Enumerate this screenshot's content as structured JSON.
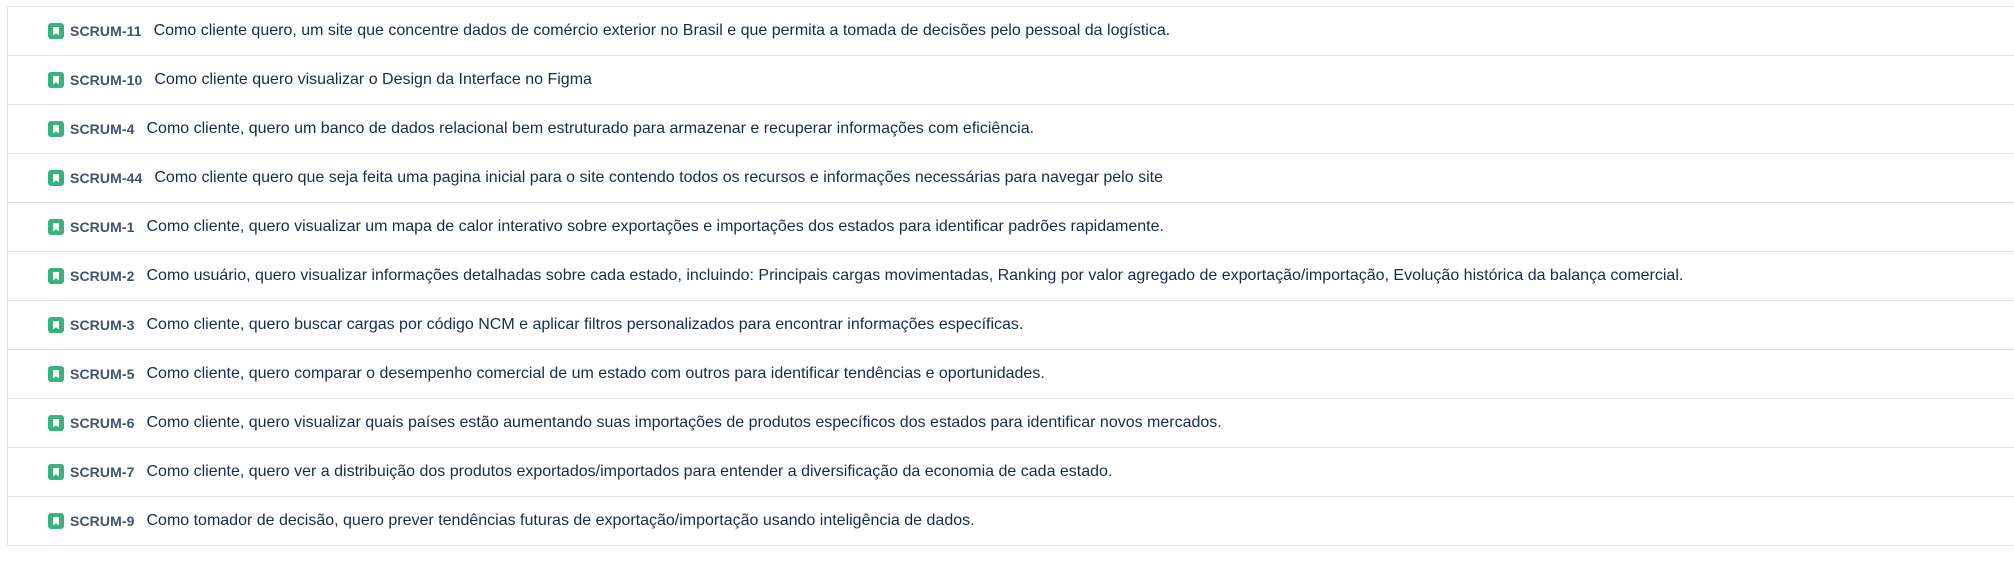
{
  "colors": {
    "story_icon": "#36b37e",
    "divider": "#dfe1e6",
    "key_text": "#42526e",
    "summary_text": "#172b4d"
  },
  "issues": [
    {
      "icon": "bookmark-icon",
      "key": "SCRUM-11",
      "summary": "Como cliente quero, um site que concentre dados de comércio exterior no Brasil e que permita a tomada de decisões pelo pessoal da logística."
    },
    {
      "icon": "bookmark-icon",
      "key": "SCRUM-10",
      "summary": "Como cliente quero visualizar o Design da Interface no Figma"
    },
    {
      "icon": "bookmark-icon",
      "key": "SCRUM-4",
      "summary": "Como cliente, quero um banco de dados relacional bem estruturado para armazenar e recuperar informações com eficiência."
    },
    {
      "icon": "bookmark-icon",
      "key": "SCRUM-44",
      "summary": "Como cliente quero que seja feita uma pagina inicial para o site contendo todos os recursos e informações necessárias para navegar pelo site"
    },
    {
      "icon": "bookmark-icon",
      "key": "SCRUM-1",
      "summary": "Como cliente, quero visualizar um mapa de calor interativo sobre exportações e importações dos estados para identificar padrões rapidamente."
    },
    {
      "icon": "bookmark-icon",
      "key": "SCRUM-2",
      "summary": "Como usuário, quero visualizar informações detalhadas sobre cada estado, incluindo: Principais cargas movimentadas, Ranking por valor agregado de exportação/importação, Evolução histórica da balança comercial."
    },
    {
      "icon": "bookmark-icon",
      "key": "SCRUM-3",
      "summary": "Como cliente, quero buscar cargas por código NCM e aplicar filtros personalizados para encontrar informações específicas."
    },
    {
      "icon": "bookmark-icon",
      "key": "SCRUM-5",
      "summary": "Como cliente, quero comparar o desempenho comercial de um estado com outros para identificar tendências e oportunidades."
    },
    {
      "icon": "bookmark-icon",
      "key": "SCRUM-6",
      "summary": "Como cliente, quero visualizar quais países estão aumentando suas importações de produtos específicos dos estados para identificar novos mercados."
    },
    {
      "icon": "bookmark-icon",
      "key": "SCRUM-7",
      "summary": "Como cliente, quero ver a distribuição dos produtos exportados/importados para entender a diversificação da economia de cada estado."
    },
    {
      "icon": "bookmark-icon",
      "key": "SCRUM-9",
      "summary": "Como tomador de decisão, quero prever tendências futuras de exportação/importação usando inteligência de dados."
    }
  ]
}
